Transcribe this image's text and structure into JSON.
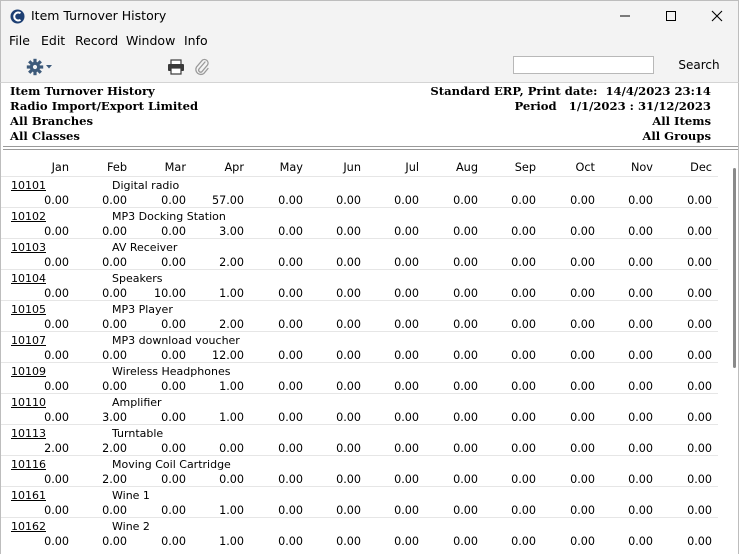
{
  "window": {
    "title": "Item Turnover History"
  },
  "menu": [
    "File",
    "Edit",
    "Record",
    "Window",
    "Info"
  ],
  "toolbar": {
    "search_label": "Search",
    "search_value": ""
  },
  "report_header": {
    "left": [
      "Item Turnover History",
      "Radio Import/Export Limited",
      "All Branches",
      "All Classes"
    ],
    "right": [
      "Standard ERP, Print date:  14/4/2023 23:14",
      "Period   1/1/2023 : 31/12/2023",
      "All Items",
      "All Groups"
    ]
  },
  "columns": [
    "Jan",
    "Feb",
    "Mar",
    "Apr",
    "May",
    "Jun",
    "Jul",
    "Aug",
    "Sep",
    "Oct",
    "Nov",
    "Dec"
  ],
  "items": [
    {
      "code": "10101",
      "name": "Digital radio",
      "values": [
        "0.00",
        "0.00",
        "0.00",
        "57.00",
        "0.00",
        "0.00",
        "0.00",
        "0.00",
        "0.00",
        "0.00",
        "0.00",
        "0.00"
      ]
    },
    {
      "code": "10102",
      "name": "MP3 Docking Station",
      "values": [
        "0.00",
        "0.00",
        "0.00",
        "3.00",
        "0.00",
        "0.00",
        "0.00",
        "0.00",
        "0.00",
        "0.00",
        "0.00",
        "0.00"
      ]
    },
    {
      "code": "10103",
      "name": "AV Receiver",
      "values": [
        "0.00",
        "0.00",
        "0.00",
        "2.00",
        "0.00",
        "0.00",
        "0.00",
        "0.00",
        "0.00",
        "0.00",
        "0.00",
        "0.00"
      ]
    },
    {
      "code": "10104",
      "name": "Speakers",
      "values": [
        "0.00",
        "0.00",
        "10.00",
        "1.00",
        "0.00",
        "0.00",
        "0.00",
        "0.00",
        "0.00",
        "0.00",
        "0.00",
        "0.00"
      ]
    },
    {
      "code": "10105",
      "name": "MP3 Player",
      "values": [
        "0.00",
        "0.00",
        "0.00",
        "2.00",
        "0.00",
        "0.00",
        "0.00",
        "0.00",
        "0.00",
        "0.00",
        "0.00",
        "0.00"
      ]
    },
    {
      "code": "10107",
      "name": "MP3 download voucher",
      "values": [
        "0.00",
        "0.00",
        "0.00",
        "12.00",
        "0.00",
        "0.00",
        "0.00",
        "0.00",
        "0.00",
        "0.00",
        "0.00",
        "0.00"
      ]
    },
    {
      "code": "10109",
      "name": "Wireless Headphones",
      "values": [
        "0.00",
        "0.00",
        "0.00",
        "1.00",
        "0.00",
        "0.00",
        "0.00",
        "0.00",
        "0.00",
        "0.00",
        "0.00",
        "0.00"
      ]
    },
    {
      "code": "10110",
      "name": "Amplifier",
      "values": [
        "0.00",
        "3.00",
        "0.00",
        "1.00",
        "0.00",
        "0.00",
        "0.00",
        "0.00",
        "0.00",
        "0.00",
        "0.00",
        "0.00"
      ]
    },
    {
      "code": "10113",
      "name": "Turntable",
      "values": [
        "2.00",
        "2.00",
        "0.00",
        "0.00",
        "0.00",
        "0.00",
        "0.00",
        "0.00",
        "0.00",
        "0.00",
        "0.00",
        "0.00"
      ]
    },
    {
      "code": "10116",
      "name": "Moving Coil Cartridge",
      "values": [
        "0.00",
        "2.00",
        "0.00",
        "0.00",
        "0.00",
        "0.00",
        "0.00",
        "0.00",
        "0.00",
        "0.00",
        "0.00",
        "0.00"
      ]
    },
    {
      "code": "10161",
      "name": "Wine 1",
      "values": [
        "0.00",
        "0.00",
        "0.00",
        "1.00",
        "0.00",
        "0.00",
        "0.00",
        "0.00",
        "0.00",
        "0.00",
        "0.00",
        "0.00"
      ]
    },
    {
      "code": "10162",
      "name": "Wine 2",
      "values": [
        "0.00",
        "0.00",
        "0.00",
        "1.00",
        "0.00",
        "0.00",
        "0.00",
        "0.00",
        "0.00",
        "0.00",
        "0.00",
        "0.00"
      ]
    }
  ]
}
